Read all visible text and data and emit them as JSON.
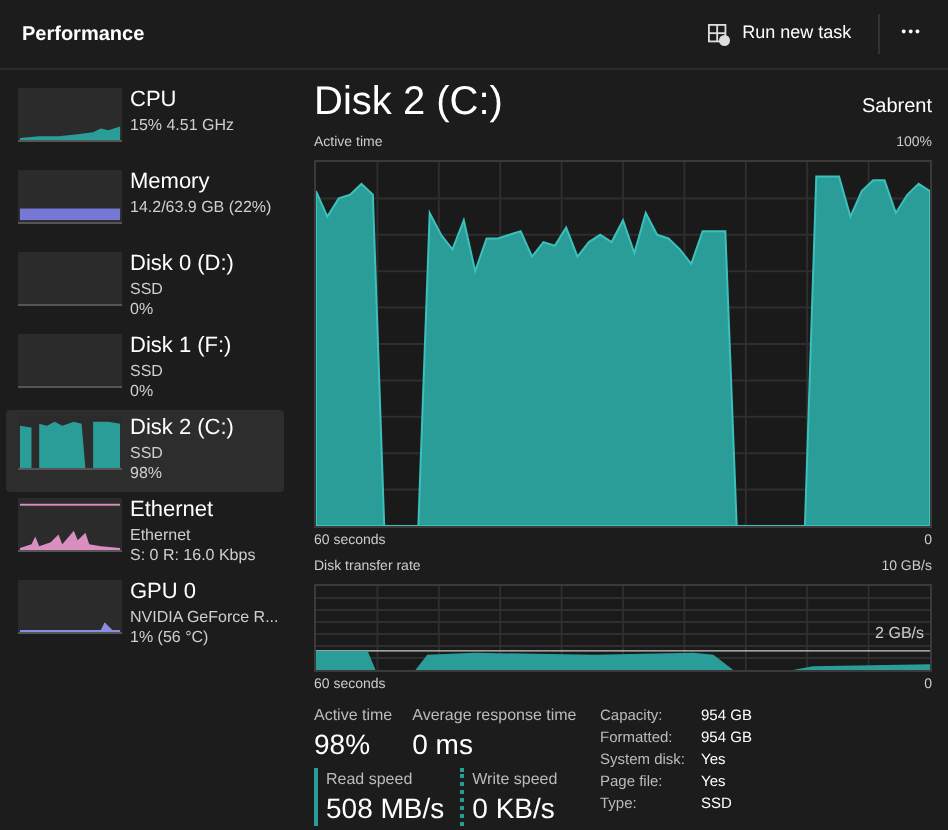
{
  "header": {
    "title": "Performance",
    "run_button": "Run new task",
    "more_button": "•••"
  },
  "sidebar": {
    "items": [
      {
        "name": "CPU",
        "lines": [
          "15%  4.51 GHz"
        ],
        "kind": "line",
        "selected": false
      },
      {
        "name": "Memory",
        "lines": [
          "14.2/63.9 GB (22%)"
        ],
        "kind": "bar",
        "selected": false
      },
      {
        "name": "Disk 0 (D:)",
        "lines": [
          "SSD",
          "0%"
        ],
        "kind": "empty",
        "selected": false
      },
      {
        "name": "Disk 1 (F:)",
        "lines": [
          "SSD",
          "0%"
        ],
        "kind": "empty",
        "selected": false
      },
      {
        "name": "Disk 2 (C:)",
        "lines": [
          "SSD",
          "98%"
        ],
        "kind": "fill",
        "selected": true
      },
      {
        "name": "Ethernet",
        "lines": [
          "Ethernet",
          "S: 0 R: 16.0 Kbps"
        ],
        "kind": "spiky",
        "selected": false
      },
      {
        "name": "GPU 0",
        "lines": [
          "NVIDIA GeForce R...",
          "1%  (56 °C)"
        ],
        "kind": "low",
        "selected": false
      }
    ]
  },
  "main": {
    "title": "Disk 2 (C:)",
    "model": "Sabrent",
    "active_chart": {
      "label": "Active time",
      "max": "100%",
      "x_start": "60 seconds",
      "x_end": "0"
    },
    "transfer_chart": {
      "label": "Disk transfer rate",
      "max": "10 GB/s",
      "mid": "2 GB/s",
      "x_start": "60 seconds",
      "x_end": "0"
    },
    "stats": [
      {
        "label": "Active time",
        "value": "98%"
      },
      {
        "label": "Average response time",
        "value": "0 ms"
      }
    ],
    "speeds": [
      {
        "label": "Read speed",
        "value": "508 MB/s",
        "kind": "solid"
      },
      {
        "label": "Write speed",
        "value": "0 KB/s",
        "kind": "dotted"
      }
    ],
    "properties": [
      {
        "label": "Capacity:",
        "value": "954 GB"
      },
      {
        "label": "Formatted:",
        "value": "954 GB"
      },
      {
        "label": "System disk:",
        "value": "Yes"
      },
      {
        "label": "Page file:",
        "value": "Yes"
      },
      {
        "label": "Type:",
        "value": "SSD"
      }
    ]
  }
}
